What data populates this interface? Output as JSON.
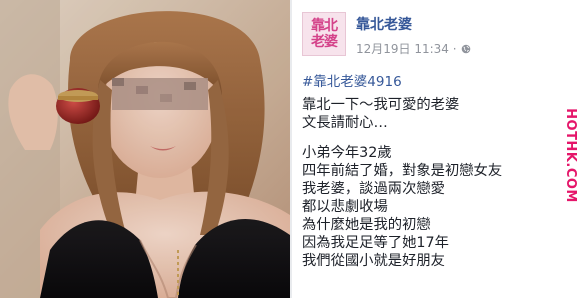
{
  "photo": {
    "description_icon": "portrait-photo",
    "face_blur": true
  },
  "post": {
    "avatar_line1": "靠北",
    "avatar_line2": "老婆",
    "author": "靠北老婆",
    "timestamp": "12月19日 11:34 ·",
    "privacy_icon": "globe-icon",
    "hashtag": "#靠北老婆4916",
    "lines": [
      "靠北一下～我可愛的老婆",
      "文長請耐心…",
      "",
      "小弟今年32歲",
      "四年前結了婚，對象是初戀女友",
      "我老婆，談過兩次戀愛",
      "都以悲劇收場",
      "為什麼她是我的初戀",
      "因為我足足等了她17年",
      "我們從國小就是好朋友"
    ]
  },
  "watermark": {
    "text": "HOTHK.COM"
  },
  "colors": {
    "link": "#365899",
    "text": "#1d2129",
    "meta": "#90949c",
    "watermark": "#e5166a",
    "avatar_text": "#d4438a"
  }
}
